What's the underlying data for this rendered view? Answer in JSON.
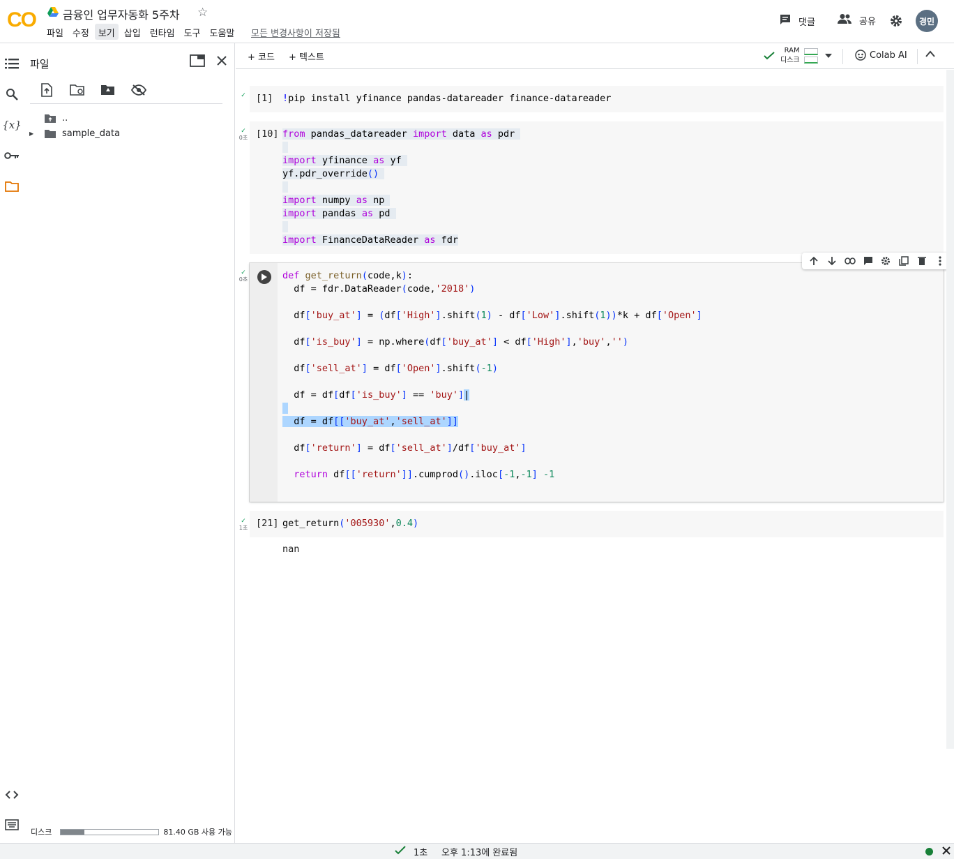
{
  "header": {
    "logo_text": "CO",
    "doc_title": "금융인 업무자동화 5주차",
    "save_status": "모든 변경사항이 저장됨",
    "comment_label": "댓글",
    "share_label": "공유",
    "avatar_text": "경민",
    "menu": [
      "파일",
      "수정",
      "보기",
      "삽입",
      "런타임",
      "도구",
      "도움말"
    ],
    "active_menu": "보기"
  },
  "file_panel": {
    "title": "파일",
    "tree": {
      "up": "..",
      "folder": "sample_data"
    },
    "disk_label": "디스크",
    "disk_free": "81.40 GB 사용 가능",
    "disk_used_fraction": 0.24
  },
  "toolbar": {
    "add_code": "+ 코드",
    "add_text": "+ 텍스트",
    "ram_label": "RAM",
    "disk_label": "디스크",
    "colab_ai": "Colab AI"
  },
  "cells": [
    {
      "exec": "[1]",
      "time": ""
    },
    {
      "exec": "[10]",
      "time": "0초"
    },
    {
      "exec": "",
      "time": "0초"
    },
    {
      "exec": "[21]",
      "time": "1초"
    }
  ],
  "output": "nan",
  "statusbar": {
    "elapsed": "1초",
    "done": "오후 1:13에 완료됨"
  },
  "colors": {
    "keyword": "#af00db",
    "string": "#a31515",
    "number": "#098658",
    "selection": "#add6ff",
    "logo_orange": "#f9ab00"
  }
}
